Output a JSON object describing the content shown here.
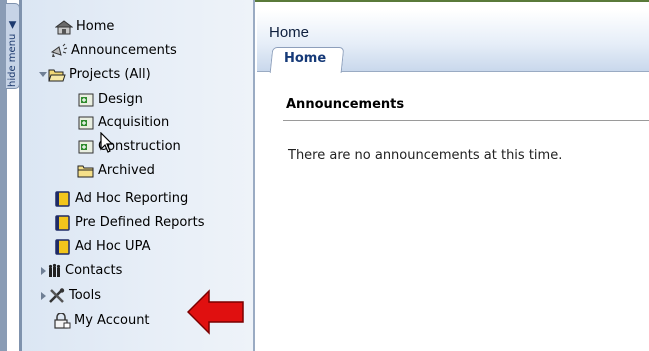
{
  "sidebar": {
    "hide_menu_label": "hide menu",
    "hide_menu_arrow": "▲",
    "items": [
      {
        "label": "Home",
        "icon": "home-icon"
      },
      {
        "label": "Announcements",
        "icon": "megaphone-icon"
      },
      {
        "label": "Projects (All)",
        "icon": "folder-open-icon"
      },
      {
        "label": "Design",
        "icon": "project-icon"
      },
      {
        "label": "Acquisition",
        "icon": "project-icon"
      },
      {
        "label": "Construction",
        "icon": "project-icon"
      },
      {
        "label": "Archived",
        "icon": "folder-icon"
      },
      {
        "label": "Ad Hoc Reporting",
        "icon": "report-icon"
      },
      {
        "label": "Pre Defined Reports",
        "icon": "report-icon"
      },
      {
        "label": "Ad Hoc UPA",
        "icon": "report-icon"
      },
      {
        "label": "Contacts",
        "icon": "contacts-icon"
      },
      {
        "label": "Tools",
        "icon": "tools-icon"
      },
      {
        "label": "My Account",
        "icon": "lock-icon"
      }
    ]
  },
  "main": {
    "title": "Home",
    "tabs": [
      {
        "label": "Home",
        "active": true
      }
    ],
    "section_title": "Announcements",
    "empty_message": "There are no announcements at this time."
  },
  "colors": {
    "sidebar_bg": "#e7eef7",
    "accent": "#163a78",
    "arrow": "#e01010"
  }
}
